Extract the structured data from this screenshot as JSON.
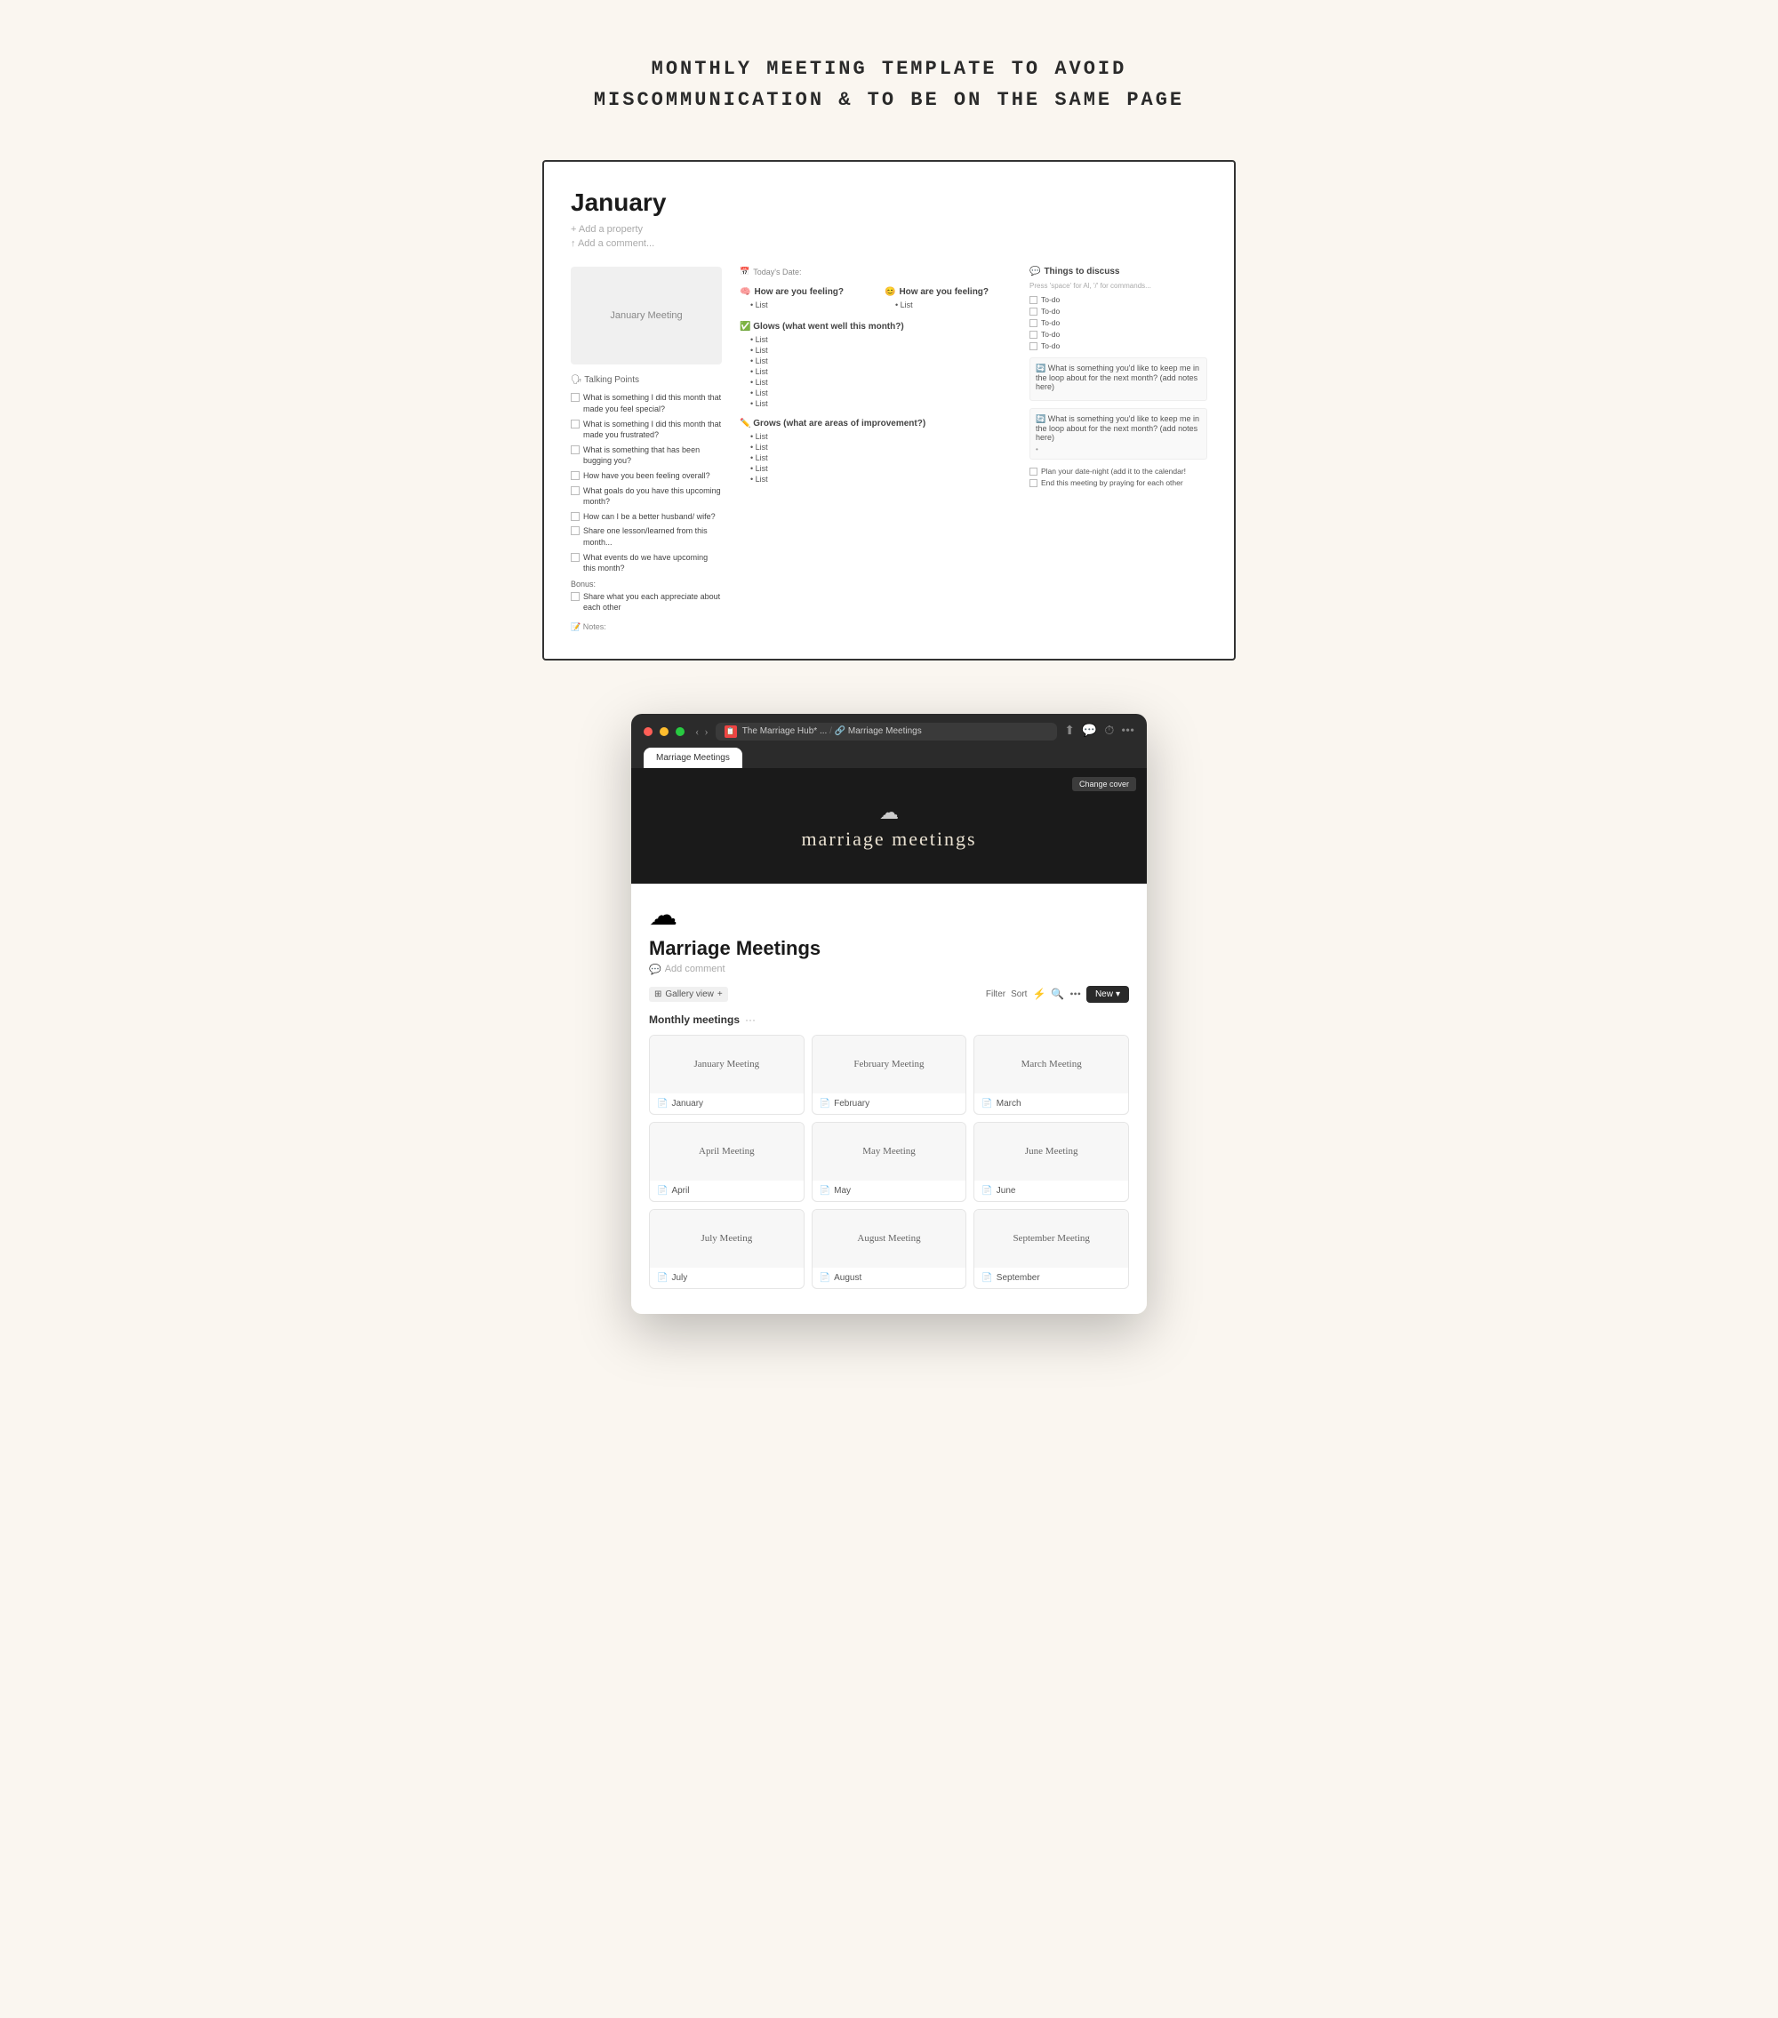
{
  "page": {
    "background_color": "#faf6f0"
  },
  "header": {
    "title_line1": "MONTHLY MEETING TEMPLATE TO AVOID",
    "title_line2": "MISCOMMUNICATION  & TO BE ON THE SAME PAGE"
  },
  "notion_page": {
    "title": "January",
    "add_property": "+ Add a property",
    "add_comment": "↑  Add a comment...",
    "image_label": "January Meeting",
    "talking_points": "🗣 Talking Points",
    "checklist_items": [
      "What is something I did this month that made you feel special?",
      "What is something I did this month that made you frustrated?",
      "What is something that has been bugging you?",
      "How have you been feeling overall?",
      "What goals do you have this upcoming month?",
      "How can I be a better husband/ wife?",
      "Share one lesson/learned from this month...",
      "What events do we have upcoming this month?"
    ],
    "bonus_label": "Bonus:",
    "bonus_item": "Share what you each appreciate about each other",
    "notes_label": "📝  Notes:",
    "todays_date_label": "Today's Date:",
    "how_feeling_label1": "How are you feeling?",
    "how_feeling_label2": "How are you feeling?",
    "list_placeholder": "• List",
    "glows_label": "✅ Glows (what went well this month?)",
    "grows_label": "✏️ Grows (what are areas of improvement?)",
    "things_to_discuss": "Things to discuss",
    "press_space_hint": "Press 'space' for Al, '/' for commands...",
    "todo_items": [
      "To-do",
      "To-do",
      "To-do",
      "To-do",
      "To-do"
    ],
    "loop_question1": "What is something you'd like to keep me in the loop about for the next month? (add notes here)",
    "loop_question2": "What is something you'd like to keep me in the loop about for the next month? (add notes here)",
    "loop_dot": "•",
    "end_items": [
      "Plan your date-night (add it to the calendar!",
      "End this meeting by praying for each other"
    ]
  },
  "browser": {
    "tab_label": "The Marriage Hub* ...",
    "page_label": "Marriage Meetings",
    "url_part1": "The Marriage Hub* ...",
    "url_sep1": "/",
    "url_part2": "Marriage Meetings",
    "change_cover": "Change cover",
    "cover_icon": "☁",
    "cover_title": "marriage meetings",
    "page_emoji": "☁",
    "db_title": "Marriage Meetings",
    "add_comment": "Add comment",
    "view_label": "Gallery view",
    "view_plus": "+",
    "filter_label": "Filter",
    "sort_label": "Sort",
    "new_label": "New",
    "group_label": "Monthly meetings",
    "group_dots": "···",
    "cards": [
      {
        "preview": "January Meeting",
        "month": "January"
      },
      {
        "preview": "February Meeting",
        "month": "February"
      },
      {
        "preview": "March Meeting",
        "month": "March"
      },
      {
        "preview": "April Meeting",
        "month": "April"
      },
      {
        "preview": "May Meeting",
        "month": "May"
      },
      {
        "preview": "June Meeting",
        "month": "June"
      },
      {
        "preview": "July Meeting",
        "month": "July"
      },
      {
        "preview": "August Meeting",
        "month": "August"
      },
      {
        "preview": "September Meeting",
        "month": "September"
      }
    ]
  }
}
